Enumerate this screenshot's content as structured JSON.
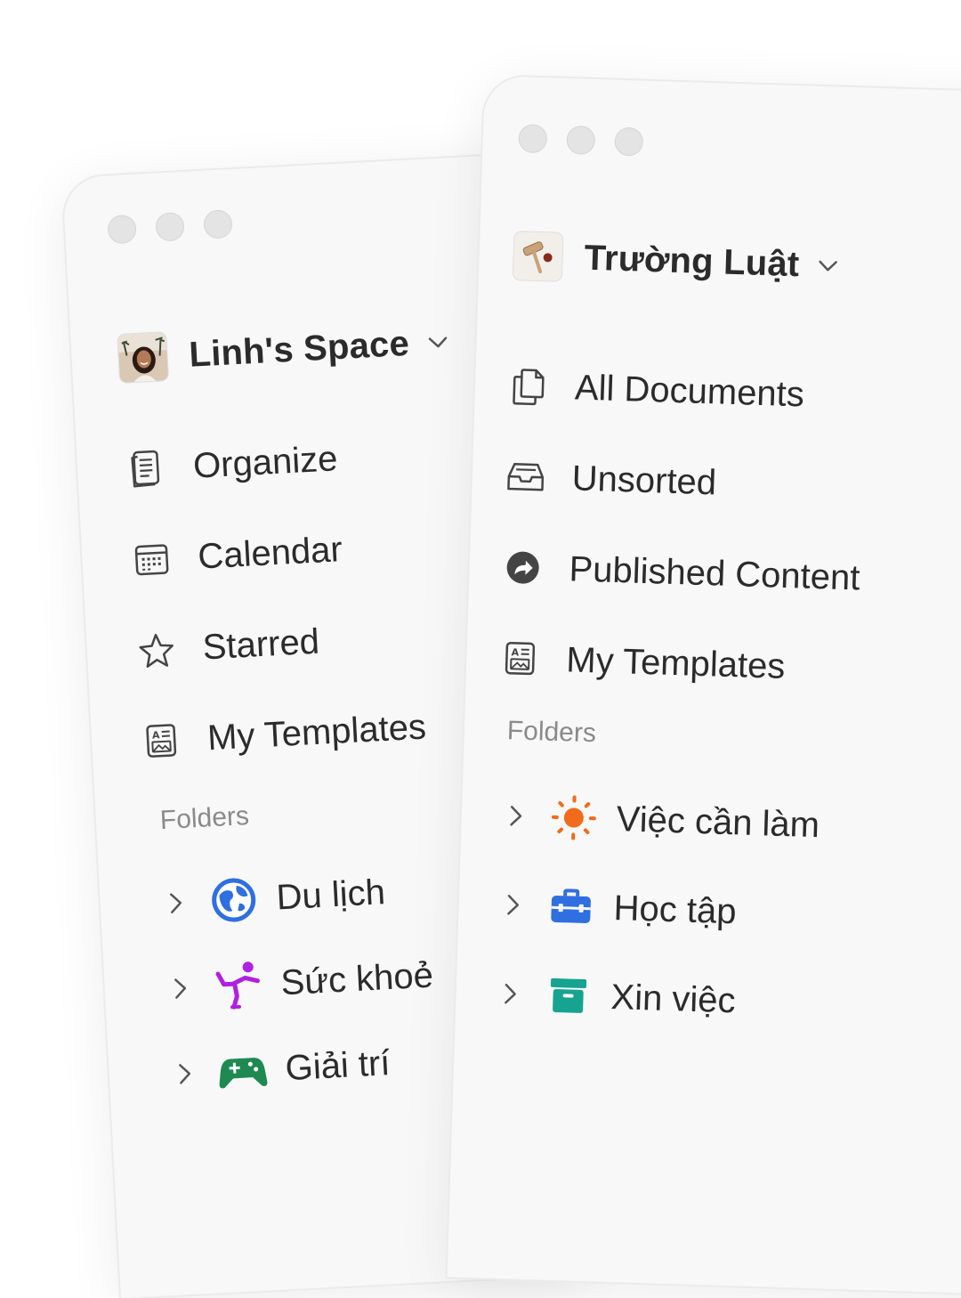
{
  "left_window": {
    "space_name": "Linh's Space",
    "nav": [
      {
        "label": "Organize",
        "icon": "document-list-icon"
      },
      {
        "label": "Calendar",
        "icon": "calendar-icon"
      },
      {
        "label": "Starred",
        "icon": "star-icon"
      },
      {
        "label": "My Templates",
        "icon": "template-icon"
      }
    ],
    "folders_title": "Folders",
    "folders": [
      {
        "label": "Du lịch",
        "icon": "globe-icon",
        "color": "#2f6fe0"
      },
      {
        "label": "Sức khoẻ",
        "icon": "dancer-icon",
        "color": "#b020e0"
      },
      {
        "label": "Giải trí",
        "icon": "gamepad-icon",
        "color": "#1e8a52"
      }
    ]
  },
  "right_window": {
    "space_name": "Trường Luật",
    "nav": [
      {
        "label": "All Documents",
        "icon": "documents-icon"
      },
      {
        "label": "Unsorted",
        "icon": "inbox-icon"
      },
      {
        "label": "Published Content",
        "icon": "share-arrow-icon"
      },
      {
        "label": "My Templates",
        "icon": "template-icon"
      }
    ],
    "folders_title": "Folders",
    "folders": [
      {
        "label": "Việc cần làm",
        "icon": "sun-icon",
        "color": "#f26a1b"
      },
      {
        "label": "Học tập",
        "icon": "briefcase-icon",
        "color": "#2f6fe0"
      },
      {
        "label": "Xin việc",
        "icon": "archive-box-icon",
        "color": "#16a38f"
      }
    ]
  }
}
